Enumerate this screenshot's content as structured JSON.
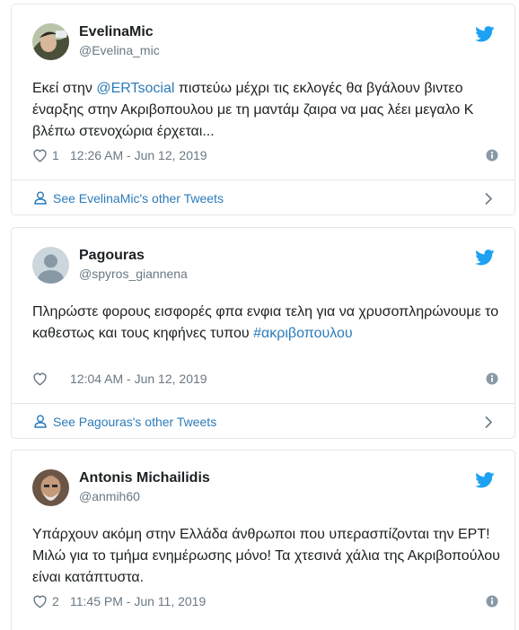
{
  "colors": {
    "link": "#2b7bb9",
    "muted": "#697882",
    "border": "#e1e8ed",
    "twitter_blue": "#1da1f2"
  },
  "tweets": [
    {
      "display_name": "EvelinaMic",
      "handle": "@Evelina_mic",
      "text_before": "Εκεί στην ",
      "mention": "@ERTsocial",
      "text_after": " πιστεύω μέχρι τις εκλογές θα βγάλουν βιντεο έναρξης στην Ακριβοπουλου με τη μαντάμ ζαιρα να μας λέει μεγαλο Κ βλέπω στενοχώρια έρχεται...",
      "likes": "1",
      "timestamp": "12:26 AM - Jun 12, 2019",
      "footer": "See EvelinaMic's other Tweets"
    },
    {
      "display_name": "Pagouras",
      "handle": "@spyros_giannena",
      "text_before": "Πληρώστε φορους εισφορές φπα ενφια τελη για να χρυσοπληρώνουμε το καθεστως και τους κηφήνες τυπου ",
      "hashtag": "#ακριβοπουλου",
      "likes": "",
      "timestamp": "12:04 AM - Jun 12, 2019",
      "footer": "See Pagouras's other Tweets"
    },
    {
      "display_name": "Antonis Michailidis",
      "handle": "@anmih60",
      "text": "Υπάρχουν ακόμη στην Ελλάδα άνθρωποι που υπερασπίζονται την ΕΡΤ! Μιλώ για το τμήμα ενημέρωσης μόνο! Τα χτεσινά χάλια της Ακριβοπούλου είναι κατάπτυστα.",
      "likes": "2",
      "timestamp": "11:45 PM - Jun 11, 2019"
    }
  ]
}
